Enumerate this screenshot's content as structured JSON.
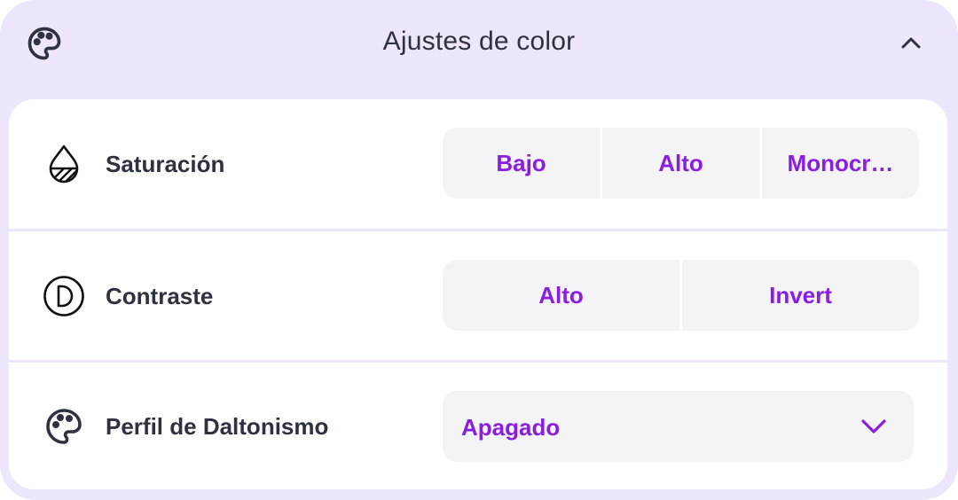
{
  "header": {
    "title": "Ajustes de color",
    "icon": "palette-icon",
    "collapse_icon": "chevron-up-icon"
  },
  "rows": {
    "saturation": {
      "label": "Saturación",
      "icon": "droplet-icon",
      "options": [
        "Bajo",
        "Alto",
        "Monocr…"
      ]
    },
    "contrast": {
      "label": "Contraste",
      "icon": "contrast-icon",
      "options": [
        "Alto",
        "Invert"
      ]
    },
    "colorblind": {
      "label": "Perfil de Daltonismo",
      "icon": "palette-icon",
      "selected": "Apagado",
      "dropdown_icon": "chevron-down-icon"
    }
  },
  "colors": {
    "panel_bg": "#ede6fc",
    "accent": "#8a1ee0",
    "text": "#2e3140",
    "option_bg": "#f4f4f6"
  }
}
